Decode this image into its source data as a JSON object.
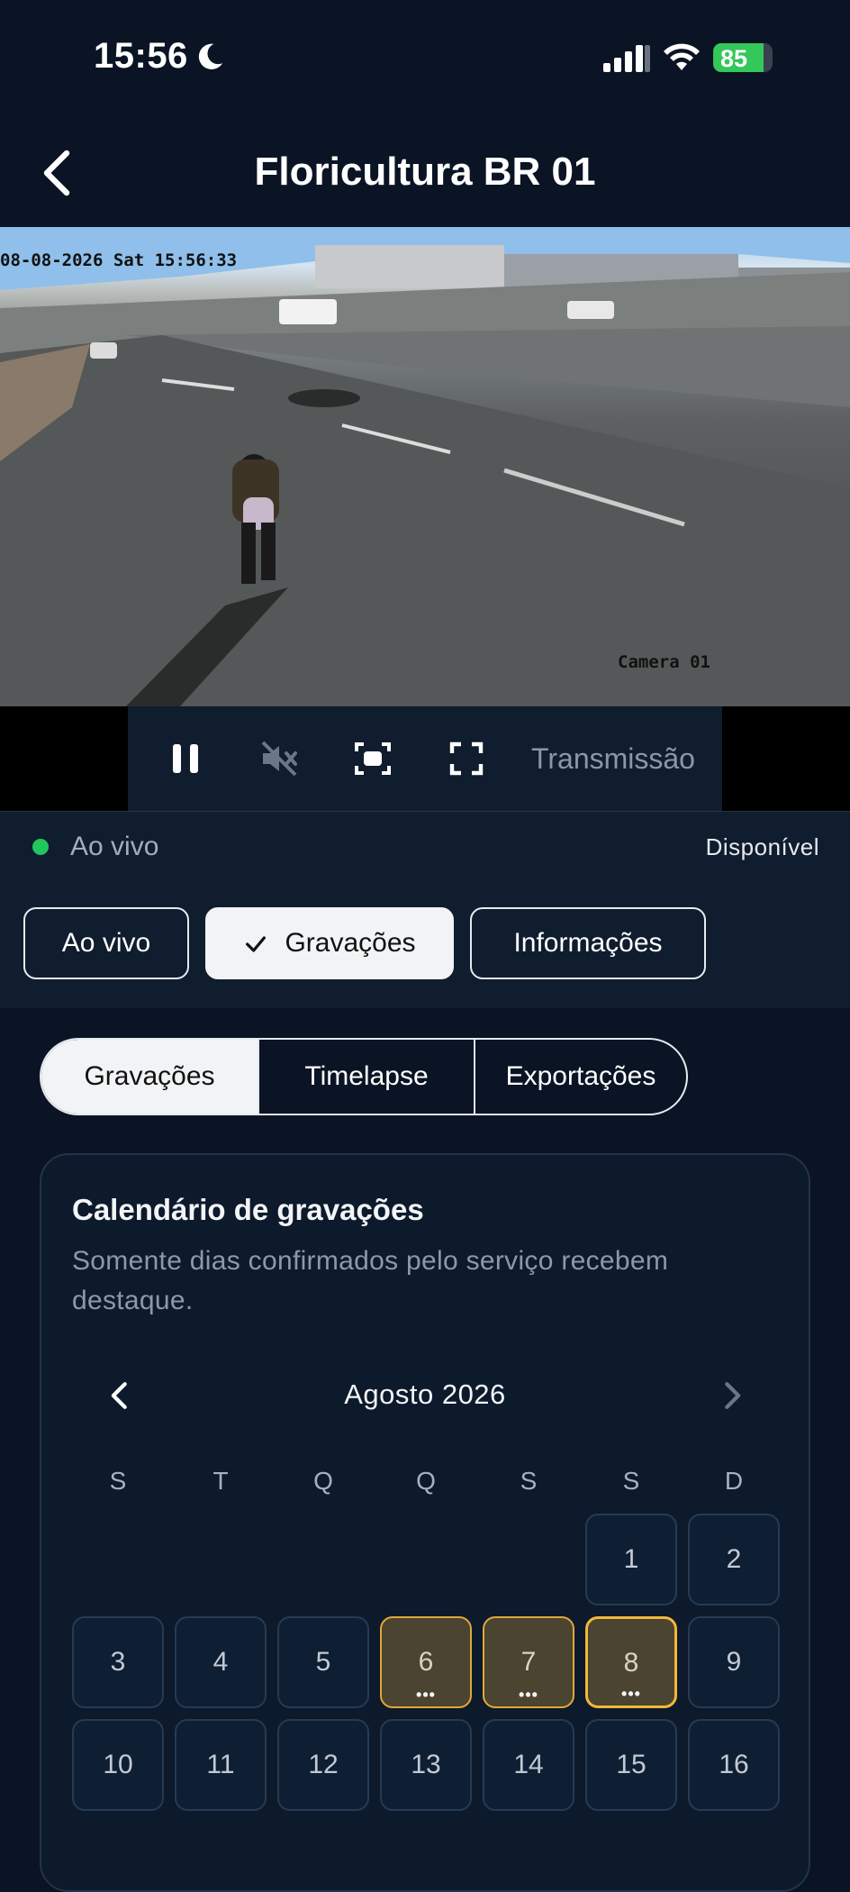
{
  "status_bar": {
    "time": "15:56",
    "battery": "85",
    "battery_level": 0.85
  },
  "header": {
    "title": "Floricultura BR 01"
  },
  "camera": {
    "timestamp": "08-08-2026 Sat 15:56:33",
    "camera_label": "Camera 01"
  },
  "controls": {
    "transmission_label": "Transmissão"
  },
  "live_status": {
    "status_text": "Ao vivo",
    "availability": "Disponível",
    "status_color": "#22c55e"
  },
  "main_tabs": [
    {
      "label": "Ao vivo"
    },
    {
      "label": "Gravações"
    },
    {
      "label": "Informações"
    }
  ],
  "sub_tabs": [
    {
      "label": "Gravações"
    },
    {
      "label": "Timelapse"
    },
    {
      "label": "Exportações"
    }
  ],
  "calendar": {
    "title": "Calendário de gravações",
    "subtitle": "Somente dias confirmados pelo serviço recebem destaque.",
    "month": "Agosto 2026",
    "weekdays": [
      "S",
      "T",
      "Q",
      "Q",
      "S",
      "S",
      "D"
    ],
    "days": [
      "1",
      "2",
      "3",
      "4",
      "5",
      "6",
      "7",
      "8",
      "9",
      "10",
      "11",
      "12",
      "13",
      "14",
      "15",
      "16"
    ],
    "recorded_days": [
      "6",
      "7",
      "8"
    ],
    "today": "8",
    "more_indicator": "•••"
  }
}
